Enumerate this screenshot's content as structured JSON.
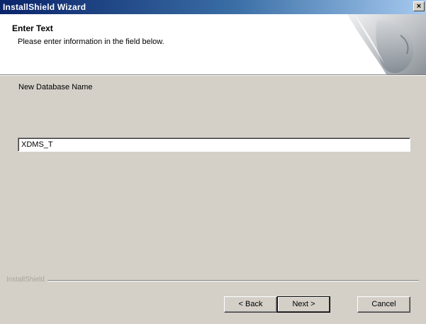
{
  "window": {
    "title": "InstallShield Wizard",
    "close_glyph": "×"
  },
  "header": {
    "title": "Enter Text",
    "subtitle": "Please enter information in the field below."
  },
  "form": {
    "field_label": "New Database Name",
    "field_value": "XDMS_T"
  },
  "footer": {
    "brand": "InstallShield",
    "back_label": "< Back",
    "next_label": "Next >",
    "cancel_label": "Cancel"
  },
  "colors": {
    "titlebar_start": "#0a246a",
    "titlebar_end": "#a6caf0",
    "dialog_bg": "#d4d0c8",
    "header_bg": "#ffffff"
  }
}
